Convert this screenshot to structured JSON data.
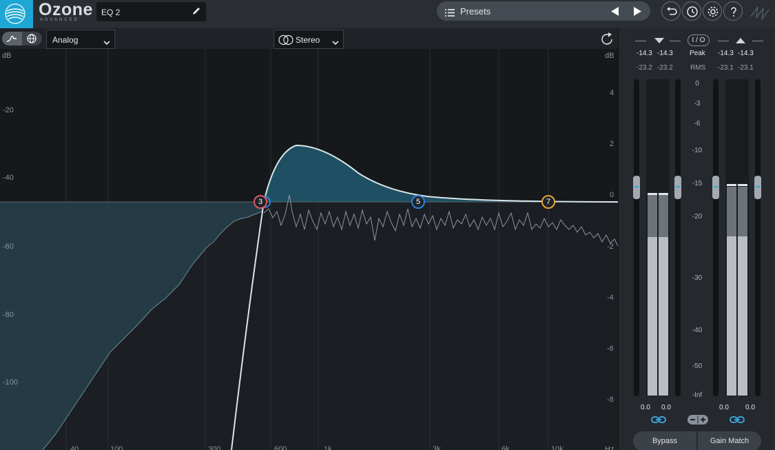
{
  "app": {
    "logo": "Ozone",
    "logo_sub": "ADVANCED"
  },
  "header": {
    "module_name": "EQ 2",
    "presets_label": "Presets",
    "icons": [
      "pencil-icon",
      "list-icon",
      "prev-arrow-icon",
      "next-arrow-icon",
      "undo-icon",
      "history-icon",
      "gear-icon",
      "help-icon",
      "scribble-icon"
    ]
  },
  "toolbar": {
    "mode_value": "Analog",
    "channel_value": "Stereo",
    "mode_options_visible": [
      "Analog"
    ],
    "channel_options_visible": [
      "Stereo"
    ]
  },
  "graph": {
    "left_unit": "dB",
    "right_unit": "dB",
    "left_scale": [
      "-20",
      "-40",
      "-60",
      "-80",
      "-100"
    ],
    "right_scale": [
      "4",
      "2",
      "0",
      "-2",
      "-4",
      "-6",
      "-8"
    ],
    "freq_labels": [
      "40",
      "100",
      "300",
      "600",
      "1k",
      "3k",
      "6k",
      "10k",
      "Hz"
    ],
    "nodes": [
      {
        "label": "3",
        "color": "#e05a63"
      },
      {
        "label": "5",
        "color": "#2f7fe0"
      },
      {
        "label": "7",
        "color": "#e3a33a"
      }
    ],
    "colors": {
      "curve": "#d8e6ec",
      "fill": "#1f4f63",
      "spectrum": "#8f969d",
      "low_fill": "#26414c"
    }
  },
  "meters": {
    "input_peak": [
      "-14.3",
      "-14.3"
    ],
    "input_rms": [
      "-23.2",
      "-23.2"
    ],
    "output_peak": [
      "-14.3",
      "-14.3"
    ],
    "output_rms": [
      "-23.1",
      "-23.1"
    ],
    "io_label": "I / O",
    "peak_label": "Peak",
    "rms_label": "RMS",
    "scale": [
      "0",
      "-3",
      "-6",
      "-10",
      "-15",
      "-20",
      "-30",
      "-40",
      "-50",
      "-Inf"
    ],
    "input_gain": [
      "0.0",
      "0.0"
    ],
    "output_gain": [
      "0.0",
      "0.0"
    ],
    "bypass_label": "Bypass",
    "gain_match_label": "Gain Match"
  }
}
